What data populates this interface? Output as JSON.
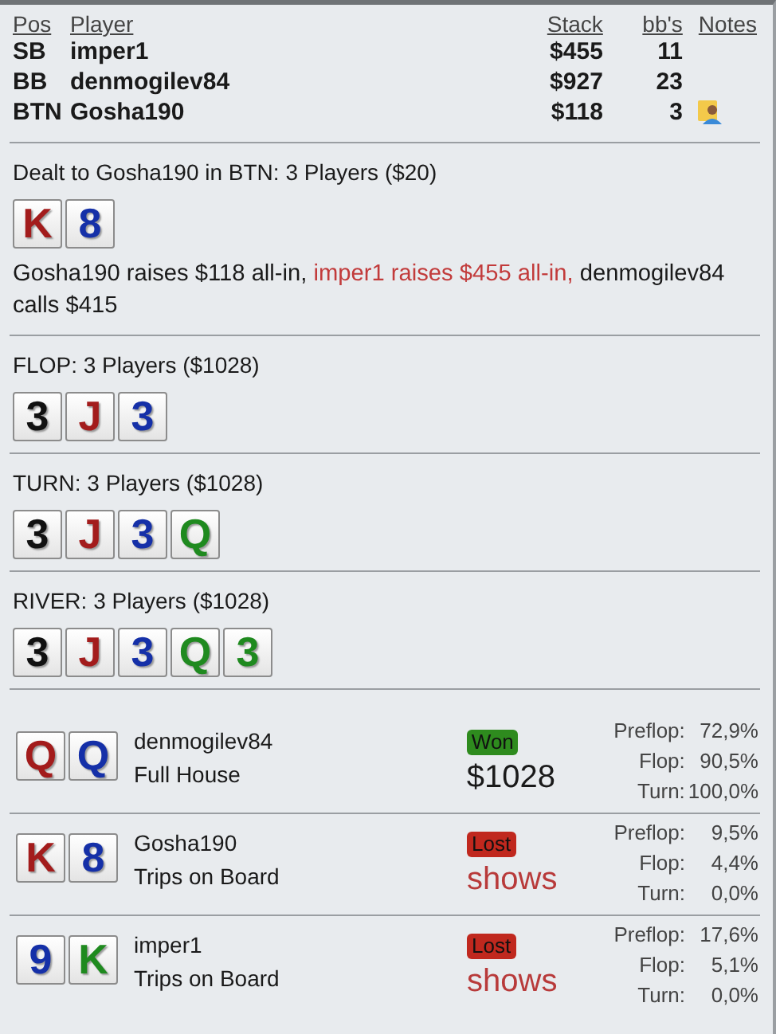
{
  "players": {
    "columns": [
      "Pos",
      "Player",
      "Stack",
      "bb's",
      "Notes"
    ],
    "rows": [
      {
        "pos": "SB",
        "player": "imper1",
        "stack": "$455",
        "bbs": "11",
        "has_note": false
      },
      {
        "pos": "BB",
        "player": "denmogilev84",
        "stack": "$927",
        "bbs": "23",
        "has_note": false
      },
      {
        "pos": "BTN",
        "player": "Gosha190",
        "stack": "$118",
        "bbs": "3",
        "has_note": true
      }
    ]
  },
  "streets": [
    {
      "title": "Dealt to Gosha190 in BTN: 3 Players ($20)",
      "cards": [
        {
          "rank": "K",
          "color": "#a31c1c"
        },
        {
          "rank": "8",
          "color": "#1530a8"
        }
      ],
      "actions": [
        {
          "text": "Gosha190 raises $118 all-in, ",
          "highlight": false
        },
        {
          "text": "imper1 raises $455 all-in, ",
          "highlight": true
        },
        {
          "text": "denmogilev84 calls $415",
          "highlight": false
        }
      ]
    },
    {
      "title": "FLOP: 3 Players ($1028)",
      "cards": [
        {
          "rank": "3",
          "color": "#111111"
        },
        {
          "rank": "J",
          "color": "#a31c1c"
        },
        {
          "rank": "3",
          "color": "#1530a8"
        }
      ]
    },
    {
      "title": "TURN: 3 Players ($1028)",
      "cards": [
        {
          "rank": "3",
          "color": "#111111"
        },
        {
          "rank": "J",
          "color": "#a31c1c"
        },
        {
          "rank": "3",
          "color": "#1530a8"
        },
        {
          "rank": "Q",
          "color": "#1f8a1f"
        }
      ]
    },
    {
      "title": "RIVER: 3 Players ($1028)",
      "cards": [
        {
          "rank": "3",
          "color": "#111111"
        },
        {
          "rank": "J",
          "color": "#a31c1c"
        },
        {
          "rank": "3",
          "color": "#1530a8"
        },
        {
          "rank": "Q",
          "color": "#1f8a1f"
        },
        {
          "rank": "3",
          "color": "#1f8a1f"
        }
      ]
    }
  ],
  "results": [
    {
      "cards": [
        {
          "rank": "Q",
          "color": "#a31c1c"
        },
        {
          "rank": "Q",
          "color": "#1530a8"
        }
      ],
      "player": "denmogilev84",
      "hand": "Full House",
      "outcome": "Won",
      "kind": "won",
      "amount": "$1028",
      "equity": [
        {
          "label": "Preflop:",
          "value": "72,9%"
        },
        {
          "label": "Flop:",
          "value": "90,5%"
        },
        {
          "label": "Turn:",
          "value": "100,0%"
        }
      ]
    },
    {
      "cards": [
        {
          "rank": "K",
          "color": "#a31c1c"
        },
        {
          "rank": "8",
          "color": "#1530a8"
        }
      ],
      "player": "Gosha190",
      "hand": "Trips on Board",
      "outcome": "Lost",
      "kind": "lost",
      "amount": "shows",
      "equity": [
        {
          "label": "Preflop:",
          "value": "9,5%"
        },
        {
          "label": "Flop:",
          "value": "4,4%"
        },
        {
          "label": "Turn:",
          "value": "0,0%"
        }
      ]
    },
    {
      "cards": [
        {
          "rank": "9",
          "color": "#1530a8"
        },
        {
          "rank": "K",
          "color": "#1f8a1f"
        }
      ],
      "player": "imper1",
      "hand": "Trips on Board",
      "outcome": "Lost",
      "kind": "lost",
      "amount": "shows",
      "equity": [
        {
          "label": "Preflop:",
          "value": "17,6%"
        },
        {
          "label": "Flop:",
          "value": "5,1%"
        },
        {
          "label": "Turn:",
          "value": "0,0%"
        }
      ]
    }
  ]
}
